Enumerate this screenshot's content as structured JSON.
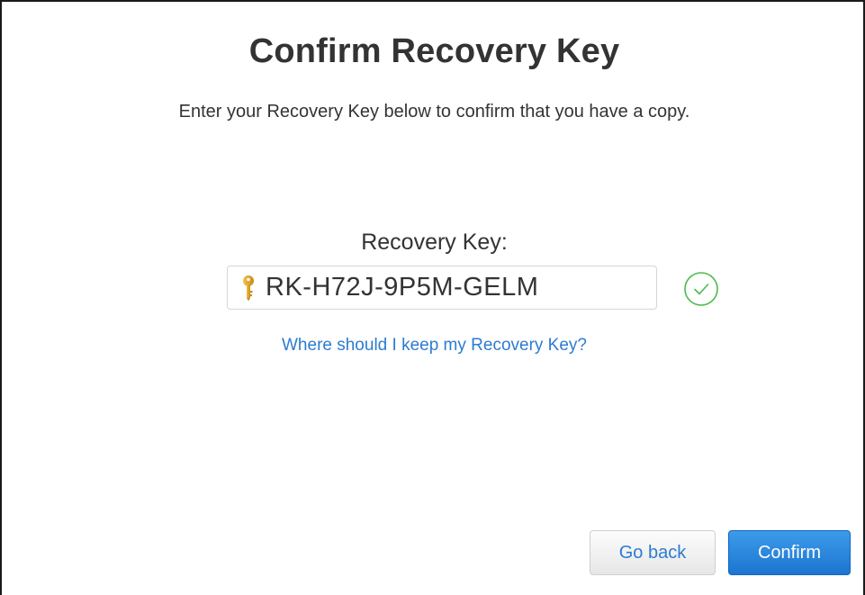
{
  "dialog": {
    "title": "Confirm Recovery Key",
    "subtitle": "Enter your Recovery Key below to confirm that you have a copy."
  },
  "recovery_key": {
    "label": "Recovery Key:",
    "value": "RK-H72J-9P5M-GELM",
    "key_icon": "key-icon",
    "status_icon": "checkmark-circle-icon",
    "status_color": "#4cbb4c"
  },
  "help": {
    "link_text": "Where should I keep my Recovery Key?"
  },
  "buttons": {
    "back_label": "Go back",
    "confirm_label": "Confirm"
  },
  "colors": {
    "link": "#2c7cd0",
    "primary_button": "#1c75d1",
    "key_icon": "#e0a52a"
  }
}
